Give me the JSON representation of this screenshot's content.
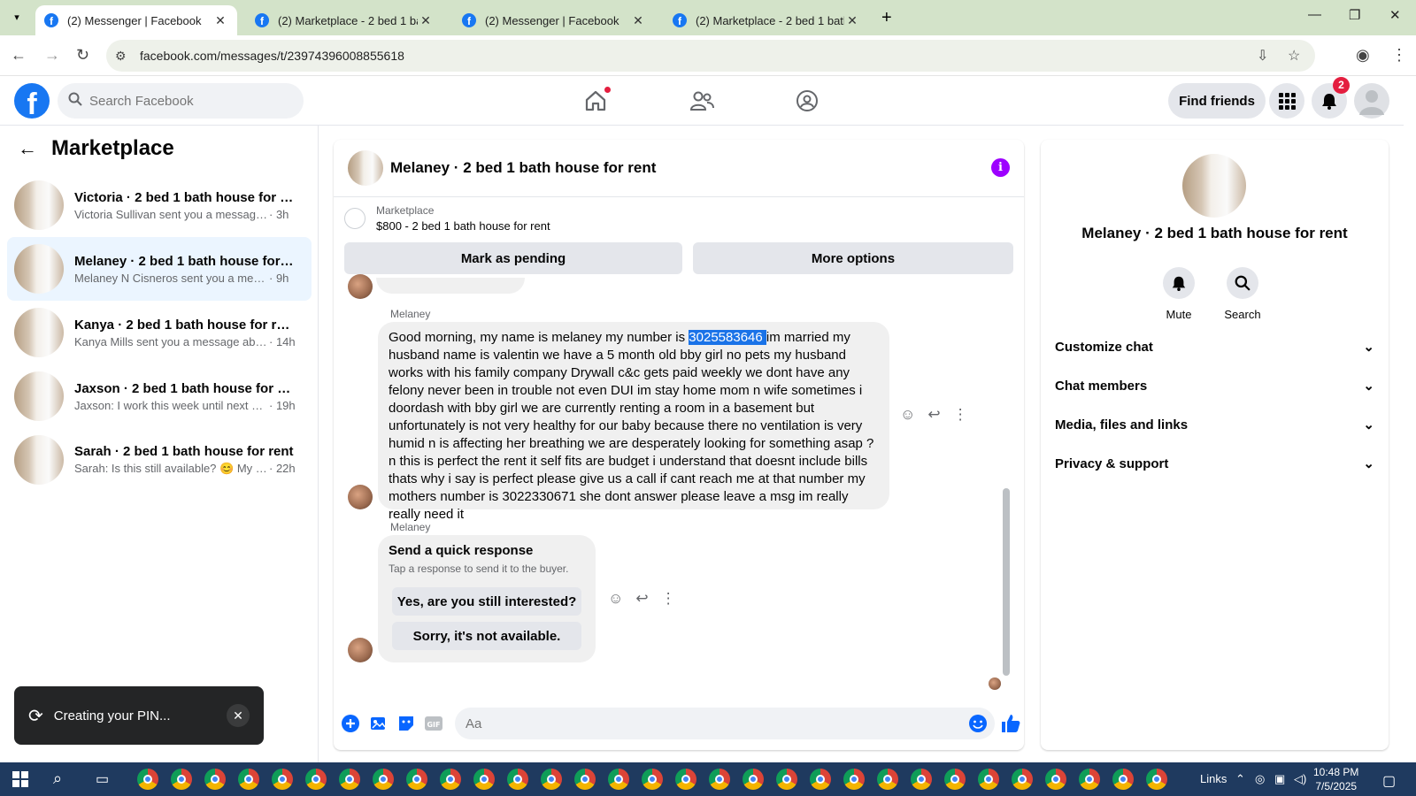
{
  "browser": {
    "tabs": [
      {
        "title": "(2) Messenger | Facebook",
        "active": true
      },
      {
        "title": "(2) Marketplace - 2 bed 1 bath",
        "active": false
      },
      {
        "title": "(2) Messenger | Facebook",
        "active": false
      },
      {
        "title": "(2) Marketplace - 2 bed 1 bath",
        "active": false
      }
    ],
    "url": "facebook.com/messages/t/23974396008855618",
    "window_controls": {
      "minimize": "—",
      "restore": "❐",
      "close": "✕"
    }
  },
  "fb_header": {
    "logo": "f",
    "search_placeholder": "Search Facebook",
    "find_friends": "Find friends",
    "notifications_count": "2"
  },
  "sidebar": {
    "title": "Marketplace",
    "conversations": [
      {
        "name": "Victoria · 2 bed 1 bath house for re...",
        "preview": "Victoria Sullivan sent you a message a...",
        "time": "· 3h",
        "selected": false
      },
      {
        "name": "Melaney · 2 bed 1 bath house for r...",
        "preview": "Melaney N Cisneros sent you a messa...",
        "time": "· 9h",
        "selected": true
      },
      {
        "name": "Kanya · 2 bed 1 bath house for rent",
        "preview": "Kanya Mills sent you a message abo...",
        "time": "· 14h",
        "selected": false
      },
      {
        "name": "Jaxson · 2 bed 1 bath house for rent",
        "preview": "Jaxson: I work this week until next Fri...",
        "time": "· 19h",
        "selected": false
      },
      {
        "name": "Sarah · 2 bed 1 bath house for rent",
        "preview": "Sarah: Is this still available? 😊 My n...",
        "time": "· 22h",
        "selected": false
      }
    ]
  },
  "toast": {
    "label": "Creating your PIN...",
    "close": "✕"
  },
  "chat": {
    "title": "Melaney · 2 bed 1 bath house for rent",
    "marketplace_label": "Marketplace",
    "listing": "$800 - 2 bed 1 bath house for rent",
    "mark_pending": "Mark as pending",
    "more_options": "More options",
    "messages": [
      {
        "sender": "Melaney",
        "text_before": "Good morning, my name is melaney my number is ",
        "text_selected": "3025583646 ",
        "text_after": "im married my husband name is valentin we have a 5 month old bby girl no pets my husband works with his family company Drywall c&c  gets paid weekly we dont have any felony never been in trouble not even DUI im stay home mom n wife sometimes i doordash with bby girl we are currently renting a room in a basement but unfortunately is not very healthy for our baby because there no ventilation is very humid n is affecting her breathing we are desperately looking for something asap ?n this is perfect the rent it self  fits are budget i understand that doesnt include bills thats why i say is perfect please give us a call if cant reach me at that number my mothers number is 3022330671 she dont answer please leave a msg im really really need it"
      },
      {
        "sender": "Melaney",
        "quick_title": "Send a quick response",
        "quick_sub": "Tap a response to send it to the buyer.",
        "options": [
          "Yes, are you still interested?",
          "Sorry, it's not available."
        ]
      }
    ],
    "composer_placeholder": "Aa"
  },
  "details": {
    "name": "Melaney · 2 bed 1 bath house for rent",
    "buttons": [
      {
        "label": "Mute",
        "icon": "bell-icon"
      },
      {
        "label": "Search",
        "icon": "search-icon"
      }
    ],
    "sections": [
      "Customize chat",
      "Chat members",
      "Media, files and links",
      "Privacy & support"
    ]
  },
  "taskbar": {
    "links_label": "Links",
    "time": "10:48 PM",
    "date": "7/5/2025"
  },
  "colors": {
    "fb_blue": "#1877f2",
    "tabstrip": "#d3e3c9",
    "selected_conv": "#ebf5ff",
    "info_purple": "#9d00ff",
    "badge_red": "#e41e3f"
  }
}
